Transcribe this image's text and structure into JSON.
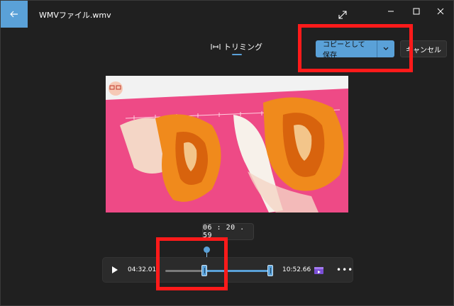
{
  "window": {
    "title": "WMVファイル.wmv"
  },
  "tabs": [
    {
      "label": "トリミング",
      "active": true
    }
  ],
  "actions": {
    "save_copy_label": "コピーとして保存",
    "cancel_label": "キャンセル"
  },
  "timeline": {
    "current_time": "06 : 20 . 59",
    "start_time": "04:32.01",
    "end_time": "10:52.66"
  },
  "colors": {
    "accent": "#5aa1d8",
    "highlight": "#ff1a1a",
    "background": "#202020"
  },
  "icons": [
    "back-arrow-icon",
    "expand-icon",
    "minimize-icon",
    "maximize-icon",
    "close-icon",
    "trim-icon",
    "chevron-down-icon",
    "play-icon",
    "clip-icon",
    "more-icon"
  ]
}
